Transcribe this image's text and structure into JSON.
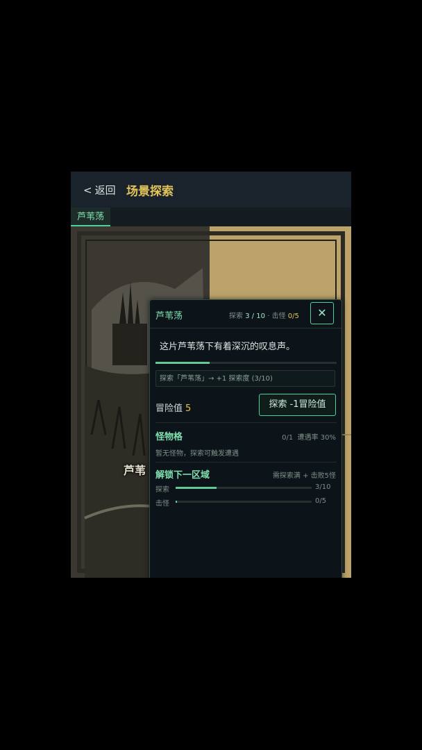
{
  "header": {
    "back_label": "返回",
    "back_icon": "chevron-left-icon",
    "title": "场景探索"
  },
  "tabs": [
    {
      "label": "芦苇荡",
      "active": true
    }
  ],
  "scene": {
    "label": "芦苇"
  },
  "panel": {
    "name": "芦苇荡",
    "explore_label": "探索",
    "explore_value": "3 / 10",
    "separator": "·",
    "kill_label": "击怪",
    "kill_value": "0/5",
    "close_icon": "close-icon",
    "description": "这片芦苇荡下有着深沉的叹息声。",
    "progress_fraction": 0.3,
    "hint": "探索「芦苇荡」→ +1 探索度 (3/10)",
    "risk_label": "冒险值",
    "risk_value": "5",
    "explore_button": "探索  -1冒险值",
    "monster": {
      "title": "怪物格",
      "count": "0/1",
      "encounter": "遭遇率 30%",
      "note": "暂无怪物，探索可触发遭遇"
    },
    "unlock": {
      "title": "解锁下一区域",
      "requirement": "需探索满 + 击败5怪",
      "rows": [
        {
          "label": "探索",
          "value": "3/10",
          "fraction": 0.3
        },
        {
          "label": "击怪",
          "value": "0/5",
          "fraction": 0.0
        }
      ]
    }
  },
  "colors": {
    "accent": "#4bd39a",
    "gold": "#e3c45a",
    "background": "#0c1419"
  }
}
